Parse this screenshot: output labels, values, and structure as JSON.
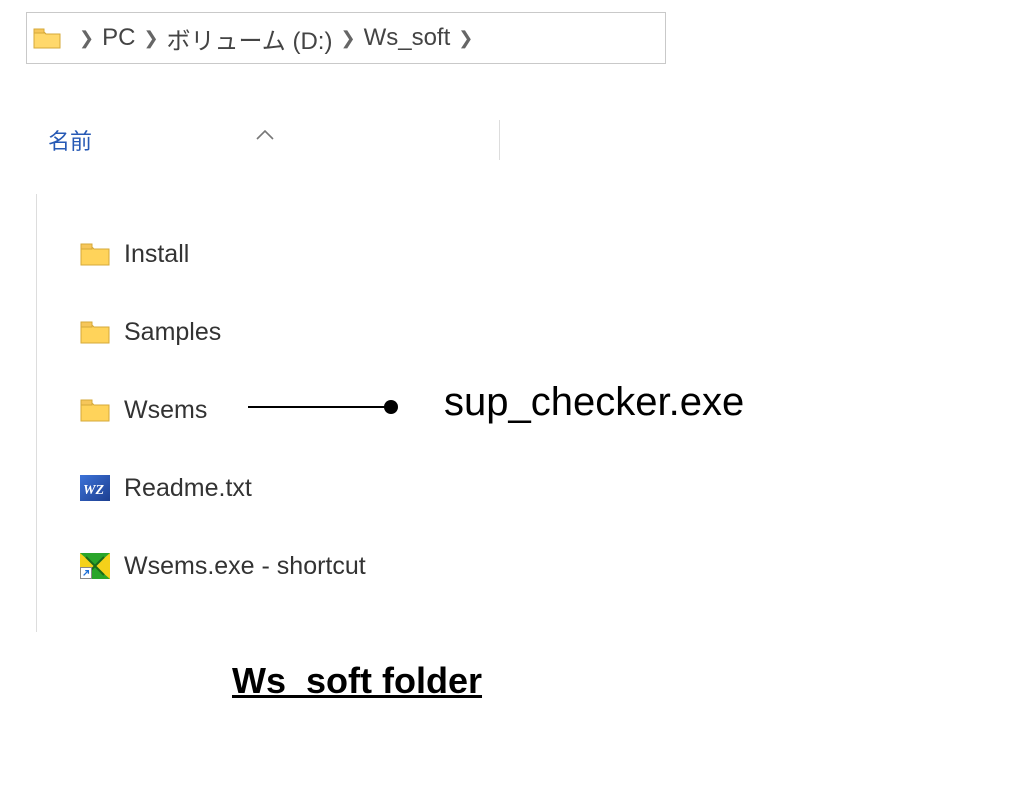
{
  "breadcrumb": {
    "items": [
      "PC",
      "ボリューム (D:)",
      "Ws_soft"
    ]
  },
  "column_header": {
    "name_label": "名前"
  },
  "files": [
    {
      "name": "Install",
      "kind": "folder"
    },
    {
      "name": "Samples",
      "kind": "folder"
    },
    {
      "name": "Wsems",
      "kind": "folder"
    },
    {
      "name": "Readme.txt",
      "kind": "wz"
    },
    {
      "name": "Wsems.exe - shortcut",
      "kind": "shortcut"
    }
  ],
  "annotation": {
    "label": "sup_checker.exe"
  },
  "caption": "Ws_soft folder"
}
